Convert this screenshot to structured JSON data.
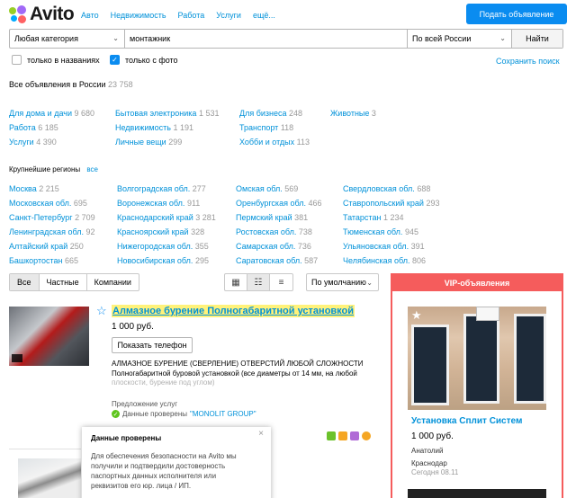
{
  "header": {
    "logo_text": "Avito",
    "nav": [
      "Авто",
      "Недвижимость",
      "Работа",
      "Услуги",
      "ещё..."
    ],
    "post_button": "Подать объявление"
  },
  "search": {
    "category": "Любая категория",
    "query": "монтажник",
    "region": "По всей России",
    "button": "Найти"
  },
  "filters": {
    "titles_only": "только в названиях",
    "with_photo": "только с фото",
    "with_photo_checked": true,
    "save_search": "Сохранить поиск"
  },
  "total": {
    "label": "Все объявления в России",
    "count": "23 758"
  },
  "categories": [
    {
      "label": "Для дома и дачи",
      "count": "9 680"
    },
    {
      "label": "Работа",
      "count": "6 185"
    },
    {
      "label": "Услуги",
      "count": "4 390"
    },
    {
      "label": "Бытовая электроника",
      "count": "1 531"
    },
    {
      "label": "Недвижимость",
      "count": "1 191"
    },
    {
      "label": "Личные вещи",
      "count": "299"
    },
    {
      "label": "Для бизнеса",
      "count": "248"
    },
    {
      "label": "Транспорт",
      "count": "118"
    },
    {
      "label": "Хобби и отдых",
      "count": "113"
    },
    {
      "label": "Животные",
      "count": "3"
    }
  ],
  "regions_header": {
    "title": "Крупнейшие регионы",
    "all": "все"
  },
  "regions": [
    {
      "label": "Москва",
      "count": "2 215"
    },
    {
      "label": "Московская обл.",
      "count": "695"
    },
    {
      "label": "Санкт-Петербург",
      "count": "2 709"
    },
    {
      "label": "Ленинградская обл.",
      "count": "92"
    },
    {
      "label": "Алтайский край",
      "count": "250"
    },
    {
      "label": "Башкортостан",
      "count": "665"
    },
    {
      "label": "Волгоградская обл.",
      "count": "277"
    },
    {
      "label": "Воронежская обл.",
      "count": "911"
    },
    {
      "label": "Краснодарский край",
      "count": "3 281"
    },
    {
      "label": "Красноярский край",
      "count": "328"
    },
    {
      "label": "Нижегородская обл.",
      "count": "355"
    },
    {
      "label": "Новосибирская обл.",
      "count": "295"
    },
    {
      "label": "Омская обл.",
      "count": "569"
    },
    {
      "label": "Оренбургская обл.",
      "count": "466"
    },
    {
      "label": "Пермский край",
      "count": "381"
    },
    {
      "label": "Ростовская обл.",
      "count": "738"
    },
    {
      "label": "Самарская обл.",
      "count": "736"
    },
    {
      "label": "Саратовская обл.",
      "count": "587"
    },
    {
      "label": "Свердловская обл.",
      "count": "688"
    },
    {
      "label": "Ставропольский край",
      "count": "293"
    },
    {
      "label": "Татарстан",
      "count": "1 234"
    },
    {
      "label": "Тюменская обл.",
      "count": "945"
    },
    {
      "label": "Ульяновская обл.",
      "count": "391"
    },
    {
      "label": "Челябинская обл.",
      "count": "806"
    }
  ],
  "tabs": [
    "Все",
    "Частные",
    "Компании"
  ],
  "sort": "По умолчанию",
  "listing": {
    "title": "Алмазное бурение Полногабаритной установкой",
    "price": "1 000 руб.",
    "phone_button": "Показать телефон",
    "desc_line1": "АЛМАЗНОЕ БУРЕНИЕ (СВЕРЛЕНИЕ) ОТВЕРСТИЙ ЛЮБОЙ СЛОЖНОСТИ",
    "desc_line2": "Полногабаритной буровой установкой (все диаметры от 14 мм, на любой",
    "desc_line3": "плоскости, бурение под углом)",
    "service_type": "Предложение услуг",
    "verified_prefix": "Данные проверены",
    "company": "\"MONOLIT GROUP\""
  },
  "tooltip": {
    "title": "Данные проверены",
    "body": "Для обеспечения безопасности на Avito мы получили и подтвердили достоверность паспортных данных исполнителя или реквизитов его юр. лица / ИП.",
    "close": "×"
  },
  "vip": {
    "header": "VIP-объявления",
    "title": "Установка Сплит Систем",
    "price": "1 000 руб.",
    "seller": "Анатолий",
    "city": "Краснодар",
    "date": "Сегодня 08.11"
  },
  "colors": {
    "accent": "#0a8cf0",
    "link": "#0091d9",
    "vip": "#f55c5c",
    "highlight": "#fff27a",
    "verified": "#5ec51d"
  }
}
